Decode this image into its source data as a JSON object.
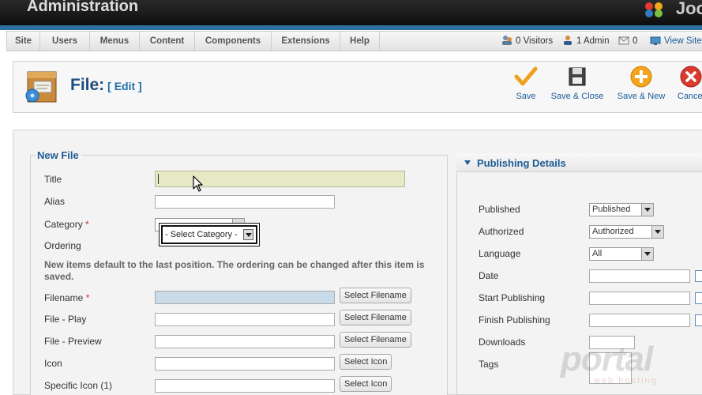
{
  "header": {
    "title": "Administration",
    "logo": "Joo"
  },
  "menu": {
    "items": [
      "Site",
      "Users",
      "Menus",
      "Content",
      "Components",
      "Extensions",
      "Help"
    ],
    "visitors": "0 Visitors",
    "admins": "1 Admin",
    "messages": "0",
    "view_site": "View Site"
  },
  "toolbar": {
    "title": "File:",
    "subtitle": "[ Edit ]",
    "buttons": [
      {
        "label": "Save",
        "icon": "checkmark-icon"
      },
      {
        "label": "Save & Close",
        "icon": "disk-icon"
      },
      {
        "label": "Save & New",
        "icon": "plus-circle-icon"
      },
      {
        "label": "Cancel",
        "icon": "cancel-icon"
      }
    ]
  },
  "form": {
    "legend": "New File",
    "title_label": "Title",
    "alias_label": "Alias",
    "category_label": "Category",
    "category_required": "*",
    "category_placeholder": "- Select Category -",
    "ordering_label": "Ordering",
    "ordering_note": "New items default to the last position. The ordering can be changed after this item is saved.",
    "filename_label": "Filename",
    "filename_required": "*",
    "file_play_label": "File - Play",
    "file_preview_label": "File - Preview",
    "icon_label": "Icon",
    "specific_icon_label": "Specific Icon (1)",
    "select_filename": "Select Filename",
    "select_icon": "Select Icon"
  },
  "publishing": {
    "title": "Publishing Details",
    "published_label": "Published",
    "published_value": "Published",
    "authorized_label": "Authorized",
    "authorized_value": "Authorized",
    "language_label": "Language",
    "language_value": "All",
    "date_label": "Date",
    "start_label": "Start Publishing",
    "finish_label": "Finish Publishing",
    "downloads_label": "Downloads",
    "tags_label": "Tags"
  },
  "watermark": {
    "main": "portal",
    "sub": "web hosting"
  },
  "colors": {
    "accent": "#1e5b94",
    "stripe": "#2d6fa0",
    "highlight": "#e6e9c4",
    "filename_bg": "#c9dbe8"
  }
}
